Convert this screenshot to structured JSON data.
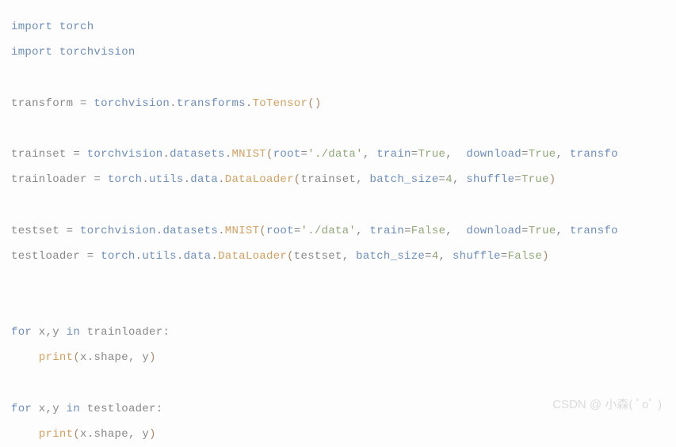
{
  "code": {
    "line1_import": "import",
    "line1_torch": "torch",
    "line2_import": "import",
    "line2_torchvision": "torchvision",
    "line4_transform": "transform ",
    "line4_eq": "=",
    "line4_torchvision": " torchvision",
    "line4_dot1": ".",
    "line4_transforms": "transforms",
    "line4_dot2": ".",
    "line4_totensor": "ToTensor",
    "line4_paren": "()",
    "line6_trainset": "trainset ",
    "line6_eq": "=",
    "line6_torchvision": " torchvision",
    "line6_dot1": ".",
    "line6_datasets": "datasets",
    "line6_dot2": ".",
    "line6_mnist": "MNIST",
    "line6_lparen": "(",
    "line6_root": "root",
    "line6_eq2": "=",
    "line6_rootval": "'./data'",
    "line6_c1": ", ",
    "line6_train": "train",
    "line6_eq3": "=",
    "line6_trainval": "True",
    "line6_c2": ",  ",
    "line6_download": "download",
    "line6_eq4": "=",
    "line6_downloadval": "True",
    "line6_c3": ", ",
    "line6_transfo": "transfo",
    "line7_trainloader": "trainloader ",
    "line7_eq": "=",
    "line7_torch": " torch",
    "line7_dot1": ".",
    "line7_utils": "utils",
    "line7_dot2": ".",
    "line7_data": "data",
    "line7_dot3": ".",
    "line7_dataloader": "DataLoader",
    "line7_lparen": "(",
    "line7_arg1": "trainset",
    "line7_c1": ", ",
    "line7_batch": "batch_size",
    "line7_eq2": "=",
    "line7_batchval": "4",
    "line7_c2": ", ",
    "line7_shuffle": "shuffle",
    "line7_eq3": "=",
    "line7_shuffleval": "True",
    "line7_rparen": ")",
    "line9_testset": "testset ",
    "line9_eq": "=",
    "line9_torchvision": " torchvision",
    "line9_dot1": ".",
    "line9_datasets": "datasets",
    "line9_dot2": ".",
    "line9_mnist": "MNIST",
    "line9_lparen": "(",
    "line9_root": "root",
    "line9_eq2": "=",
    "line9_rootval": "'./data'",
    "line9_c1": ", ",
    "line9_train": "train",
    "line9_eq3": "=",
    "line9_trainval": "False",
    "line9_c2": ",  ",
    "line9_download": "download",
    "line9_eq4": "=",
    "line9_downloadval": "True",
    "line9_c3": ", ",
    "line9_transfo": "transfo",
    "line10_testloader": "testloader ",
    "line10_eq": "=",
    "line10_torch": " torch",
    "line10_dot1": ".",
    "line10_utils": "utils",
    "line10_dot2": ".",
    "line10_data": "data",
    "line10_dot3": ".",
    "line10_dataloader": "DataLoader",
    "line10_lparen": "(",
    "line10_arg1": "testset",
    "line10_c1": ", ",
    "line10_batch": "batch_size",
    "line10_eq2": "=",
    "line10_batchval": "4",
    "line10_c2": ", ",
    "line10_shuffle": "shuffle",
    "line10_eq3": "=",
    "line10_shuffleval": "False",
    "line10_rparen": ")",
    "line13_for": "for",
    "line13_xy": " x,y ",
    "line13_in": "in",
    "line13_iter": " trainloader",
    "line13_colon": ":",
    "line14_indent": "    ",
    "line14_print": "print",
    "line14_lparen": "(",
    "line14_x": "x",
    "line14_dot": ".",
    "line14_shape": "shape",
    "line14_c": ", ",
    "line14_y": "y",
    "line14_rparen": ")",
    "line16_for": "for",
    "line16_xy": " x,y ",
    "line16_in": "in",
    "line16_iter": " testloader",
    "line16_colon": ":",
    "line17_indent": "    ",
    "line17_print": "print",
    "line17_lparen": "(",
    "line17_x": "x",
    "line17_dot": ".",
    "line17_shape": "shape",
    "line17_c": ", ",
    "line17_y": "y",
    "line17_rparen": ")"
  },
  "watermark": "CSDN @ 小森( ﾟoﾟ )"
}
